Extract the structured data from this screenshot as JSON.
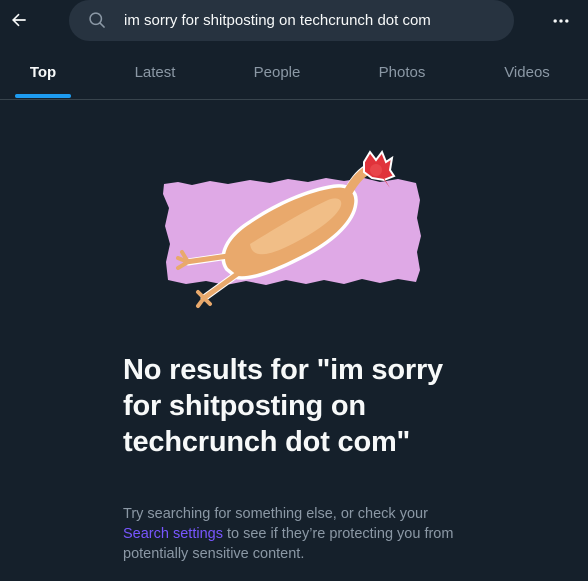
{
  "search": {
    "query": "im sorry for shitposting on techcrunch dot com"
  },
  "tabs": [
    {
      "label": "Top",
      "active": true
    },
    {
      "label": "Latest",
      "active": false
    },
    {
      "label": "People",
      "active": false
    },
    {
      "label": "Photos",
      "active": false
    },
    {
      "label": "Videos",
      "active": false
    }
  ],
  "empty_state": {
    "headline": "No results for \"im sorry for shitposting on techcrunch dot com\"",
    "desc_before": "Try searching for something else, or check your ",
    "desc_link": "Search settings",
    "desc_after": " to see if they’re protecting you from potentially sensitive content."
  },
  "icons": {
    "back": "arrow-left-icon",
    "search": "search-icon",
    "more": "more-horizontal-icon"
  },
  "colors": {
    "background": "#15202b",
    "search_bg": "#273340",
    "accent": "#1d9bf0",
    "link": "#7856ff",
    "illustration_bg": "#dfa9e6"
  }
}
